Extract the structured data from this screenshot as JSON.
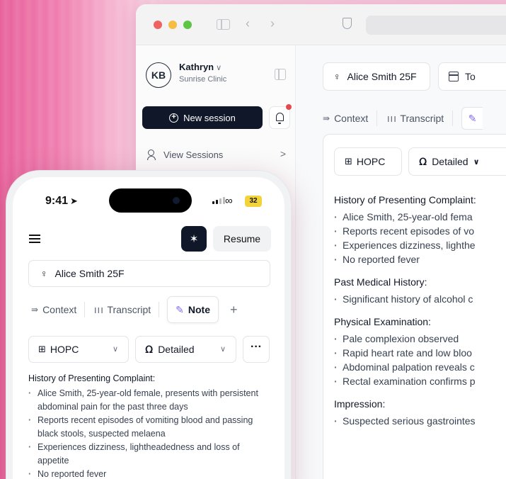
{
  "desktop": {
    "user": {
      "initials": "KB",
      "name": "Kathryn",
      "chevron": "∨",
      "clinic": "Sunrise Clinic"
    },
    "sidebar": {
      "new_session_label": "New session",
      "view_sessions_label": "View Sessions",
      "view_sessions_chevron": ">"
    },
    "header": {
      "patient_label": "Alice Smith 25F",
      "date_label": "To"
    },
    "tabs": [
      {
        "icon": "⇛",
        "label": "Context"
      },
      {
        "icon": "❙❙❙",
        "label": "Transcript"
      }
    ],
    "note": {
      "template_label": "HOPC",
      "detail_label": "Detailed",
      "sections": [
        {
          "title": "History of Presenting Complaint:",
          "items": [
            "Alice Smith, 25-year-old fema",
            "Reports recent episodes of vo",
            "Experiences dizziness, lighthe",
            "No reported fever"
          ]
        },
        {
          "title": "Past Medical History:",
          "items": [
            "Significant history of alcohol c"
          ]
        },
        {
          "title": "Physical Examination:",
          "items": [
            "Pale complexion observed",
            "Rapid heart rate and low bloo",
            "Abdominal palpation reveals c",
            "Rectal examination confirms p"
          ]
        },
        {
          "title": "Impression:",
          "items": [
            "Suspected serious gastrointes"
          ]
        }
      ]
    },
    "colors": {
      "dark_button": "#0f1729",
      "accent": "#7c6cf0",
      "notification": "#e5484d"
    }
  },
  "phone": {
    "status": {
      "time": "9:41",
      "battery": "32"
    },
    "resume_label": "Resume",
    "patient_label": "Alice Smith 25F",
    "tabs": {
      "context": "Context",
      "transcript": "Transcript",
      "note": "Note",
      "add": "+"
    },
    "template_label": "HOPC",
    "detail_label": "Detailed",
    "more_label": "···",
    "section_title": "History of Presenting Complaint:",
    "items": [
      "Alice Smith, 25-year-old female, presents with persistent abdominal pain for the past three days",
      "Reports recent episodes of vomiting blood and passing black stools, suspected melaena",
      "Experiences dizziness, lightheadedness and loss of appetite",
      "No reported fever"
    ]
  }
}
